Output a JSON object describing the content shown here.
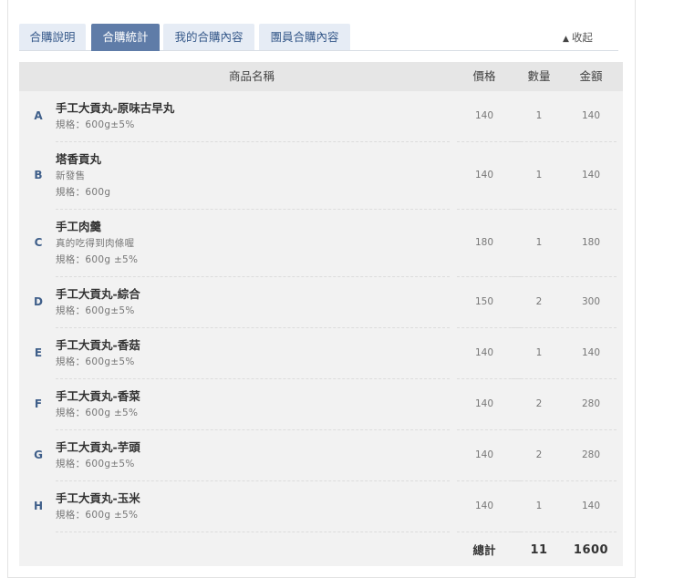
{
  "tabs": [
    {
      "label": "合購說明"
    },
    {
      "label": "合購統計"
    },
    {
      "label": "我的合購內容"
    },
    {
      "label": "團員合購內容"
    }
  ],
  "collapse_label": "收起",
  "collapse_icon": "triangle-up-icon",
  "table": {
    "headers": {
      "name": "商品名稱",
      "price": "價格",
      "qty": "數量",
      "amount": "金額"
    },
    "rows": [
      {
        "letter": "A",
        "name": "手工大貢丸-原味古早丸",
        "lines": [
          "規格：600g±5%"
        ],
        "price": "140",
        "qty": "1",
        "amount": "140"
      },
      {
        "letter": "B",
        "name": "塔香貢丸",
        "lines": [
          "新發售",
          "規格：600g"
        ],
        "price": "140",
        "qty": "1",
        "amount": "140"
      },
      {
        "letter": "C",
        "name": "手工肉羹",
        "lines": [
          "真的吃得到肉條喔",
          "規格：600g ±5%"
        ],
        "price": "180",
        "qty": "1",
        "amount": "180"
      },
      {
        "letter": "D",
        "name": "手工大貢丸-綜合",
        "lines": [
          "規格：600g±5%"
        ],
        "price": "150",
        "qty": "2",
        "amount": "300"
      },
      {
        "letter": "E",
        "name": "手工大貢丸-香菇",
        "lines": [
          "規格：600g±5%"
        ],
        "price": "140",
        "qty": "1",
        "amount": "140"
      },
      {
        "letter": "F",
        "name": "手工大貢丸-香菜",
        "lines": [
          "規格：600g ±5%"
        ],
        "price": "140",
        "qty": "2",
        "amount": "280"
      },
      {
        "letter": "G",
        "name": "手工大貢丸-芋頭",
        "lines": [
          "規格：600g±5%"
        ],
        "price": "140",
        "qty": "2",
        "amount": "280"
      },
      {
        "letter": "H",
        "name": "手工大貢丸-玉米",
        "lines": [
          "規格：600g ±5%"
        ],
        "price": "140",
        "qty": "1",
        "amount": "140"
      }
    ],
    "footer": {
      "label": "總計",
      "qty": "11",
      "amount": "1600"
    }
  },
  "colors": {
    "accent": "#5f7ca8",
    "tab_bg": "#e6ecf5",
    "letter": "#3f5f8a"
  }
}
